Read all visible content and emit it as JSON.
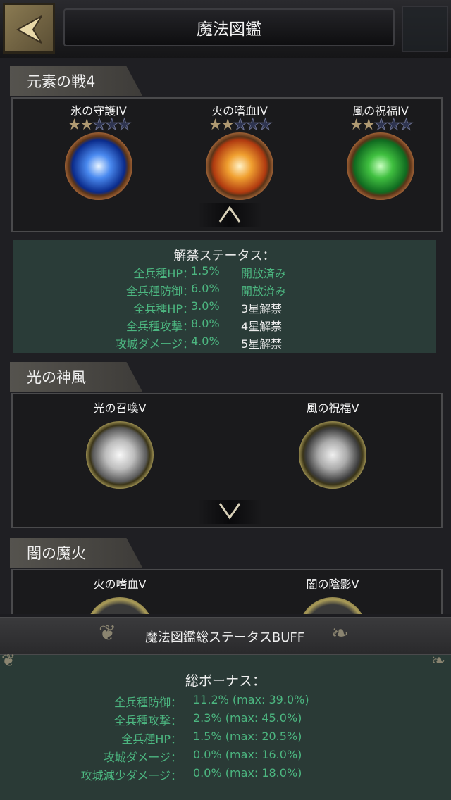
{
  "header": {
    "title": "魔法図鑑"
  },
  "sections": [
    {
      "title": "元素の戦4",
      "cards": [
        {
          "name": "氷の守護IV",
          "stars": 2,
          "max_stars": 5,
          "orb": "ice-orb-icon"
        },
        {
          "name": "火の嗜血IV",
          "stars": 2,
          "max_stars": 5,
          "orb": "fire-orb-icon"
        },
        {
          "name": "風の祝福IV",
          "stars": 2,
          "max_stars": 5,
          "orb": "wind-orb-icon"
        }
      ],
      "toggle": "collapse"
    },
    {
      "title": "光の神風",
      "cards": [
        {
          "name": "光の召喚V",
          "orb": "light-summon-orb-icon"
        },
        {
          "name": "風の祝福V",
          "orb": "wind-orb-icon"
        }
      ],
      "toggle": "expand"
    },
    {
      "title": "闇の魔火",
      "cards": [
        {
          "name": "火の嗜血V"
        },
        {
          "name": "闇の陰影V"
        }
      ]
    }
  ],
  "unlock_status": {
    "title": "解禁ステータス：",
    "rows": [
      {
        "label": "全兵種HP：",
        "value": "1.5%",
        "status": "開放済み",
        "unlocked": true
      },
      {
        "label": "全兵種防御：",
        "value": "6.0%",
        "status": "開放済み",
        "unlocked": true
      },
      {
        "label": "全兵種HP：",
        "value": "3.0%",
        "status": "3星解禁",
        "unlocked": false
      },
      {
        "label": "全兵種攻撃：",
        "value": "8.0%",
        "status": "4星解禁",
        "unlocked": false
      },
      {
        "label": "攻城ダメージ：",
        "value": "4.0%",
        "status": "5星解禁",
        "unlocked": false
      }
    ]
  },
  "buff": {
    "title": "魔法図鑑総ステータスBUFF",
    "total_title": "総ボーナス：",
    "rows": [
      {
        "label": "全兵種防御：",
        "value": "11.2% (max: 39.0%)"
      },
      {
        "label": "全兵種攻撃：",
        "value": "2.3% (max: 45.0%)"
      },
      {
        "label": "全兵種HP：",
        "value": "1.5% (max: 20.5%)"
      },
      {
        "label": "攻城ダメージ：",
        "value": "0.0% (max: 16.0%)"
      },
      {
        "label": "攻城減少ダメージ：",
        "value": "0.0% (max: 18.0%)"
      }
    ]
  },
  "colors": {
    "accent_green": "#4cb680",
    "panel_teal": "#2a3c38",
    "star_gold": "#b09a72"
  }
}
